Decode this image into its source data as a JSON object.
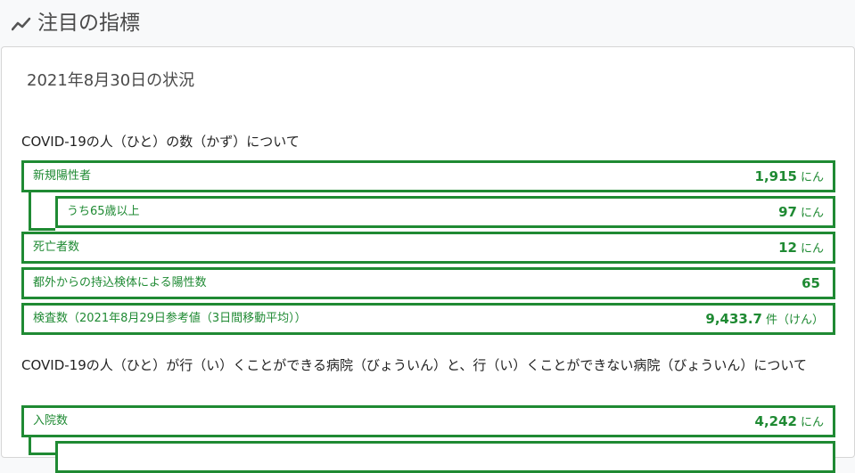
{
  "header": {
    "title": "注目の指標",
    "icon": "trend-line-icon"
  },
  "card": {
    "date": "2021年8月30日の状況",
    "section1": {
      "title": "COVID-19の人（ひと）の数（かず）について",
      "rows": [
        {
          "label": "新規陽性者",
          "value": "1,915",
          "unit": "にん"
        },
        {
          "label": "うち65歳以上",
          "value": "97",
          "unit": "にん"
        },
        {
          "label": "死亡者数",
          "value": "12",
          "unit": "にん"
        },
        {
          "label": "都外からの持込検体による陽性数",
          "value": "65",
          "unit": ""
        },
        {
          "label": "検査数（2021年8月29日参考値（3日間移動平均））",
          "value": "9,433.7",
          "unit": "件（けん）"
        }
      ]
    },
    "section2": {
      "title": "COVID-19の人（ひと）が行（い）くことができる病院（びょういん）と、行（い）くことができない病院（びょういん）について",
      "rows": [
        {
          "label": "入院数",
          "value": "4,242",
          "unit": "にん"
        }
      ]
    }
  },
  "colors": {
    "accent": "#1f8a33"
  }
}
